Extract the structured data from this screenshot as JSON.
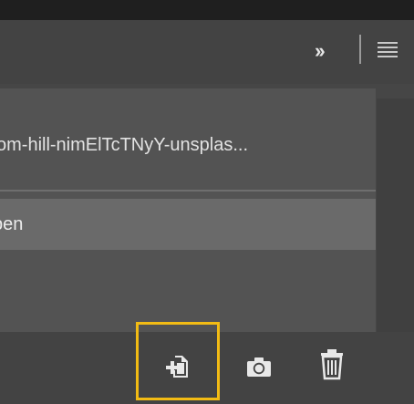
{
  "panel": {
    "history_items": [
      {
        "label": "om-hill-nimElTcTNyY-unsplas..."
      },
      {
        "label": "pen"
      }
    ]
  },
  "colors": {
    "highlight": "#f2bb14",
    "selected_row": "#6a6a6a",
    "panel_bg": "#535353"
  },
  "icons": {
    "header": [
      "collapse-panels-icon",
      "panel-menu-icon"
    ],
    "footer": [
      "new-document-from-state-icon",
      "camera-icon",
      "trash-icon"
    ]
  }
}
